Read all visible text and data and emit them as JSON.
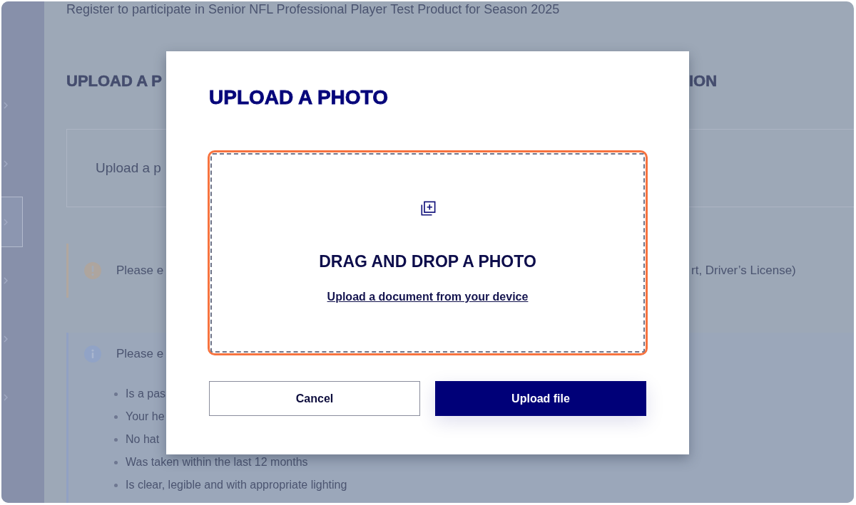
{
  "page": {
    "intro": "Register to participate in Senior NFL Professional Player Test Product for Season 2025"
  },
  "sidebar": {
    "items": [
      {
        "selected": false
      },
      {
        "selected": false
      },
      {
        "selected": true
      },
      {
        "selected": false
      },
      {
        "selected": false
      },
      {
        "selected": false
      }
    ]
  },
  "section": {
    "heading": {
      "left": "UPLOAD A P",
      "right": "ION"
    },
    "upload_card": {
      "text": "Upload a p"
    },
    "alerts": [
      {
        "kind": "warning",
        "text_left": "Please e",
        "text_right": "rt, Driver’s License)"
      },
      {
        "kind": "info",
        "text_left": "Please e",
        "bullets": [
          "Is a pas",
          "Your he",
          "No hat",
          "Was taken within the last 12 months",
          "Is clear, legible and with appropriate lighting"
        ]
      }
    ]
  },
  "modal": {
    "title": "UPLOAD A PHOTO",
    "dropzone": {
      "highlighted": true,
      "heading": "DRAG AND DROP A PHOTO",
      "link": "Upload a document from your device"
    },
    "buttons": [
      {
        "kind": "secondary",
        "label": "Cancel"
      },
      {
        "kind": "primary",
        "label": "Upload file"
      }
    ]
  }
}
